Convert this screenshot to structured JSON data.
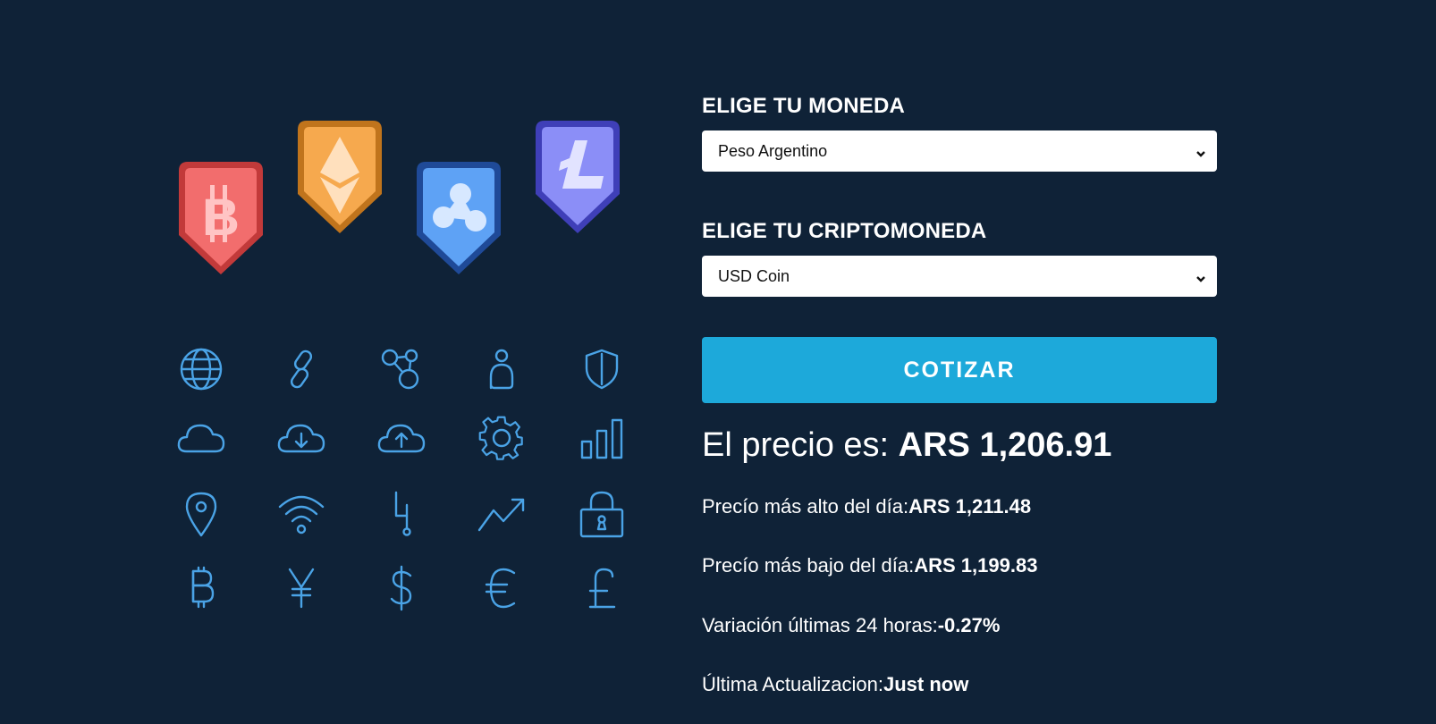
{
  "form": {
    "currency_label": "Elige tu Moneda",
    "currency_selected": "Peso Argentino",
    "crypto_label": "Elige tu Criptomoneda",
    "crypto_selected": "USD Coin",
    "submit_label": "Cotizar"
  },
  "result": {
    "price_prefix": "El precio es: ",
    "price_value": "ARS 1,206.91",
    "high_label": "Precío más alto del día:",
    "high_value": "ARS 1,211.48",
    "low_label": "Precío más bajo del día:",
    "low_value": "ARS 1,199.83",
    "change_label": "Variación últimas 24 horas:",
    "change_value": "-0.27%",
    "updated_label": "Última Actualizacion:",
    "updated_value": "Just now"
  },
  "illustration": {
    "badges": [
      "bitcoin-badge",
      "ethereum-badge",
      "ripple-badge",
      "litecoin-badge"
    ],
    "badge_colors": {
      "bitcoin": "#f26d6d",
      "ethereum": "#f6a94e",
      "ripple": "#5ea2f5",
      "litecoin": "#8b8ef7"
    },
    "icons": [
      "globe-icon",
      "chain-link-icon",
      "network-nodes-icon",
      "user-icon",
      "shield-icon",
      "cloud-icon",
      "cloud-download-icon",
      "cloud-upload-icon",
      "gear-icon",
      "bar-chart-icon",
      "location-pin-icon",
      "wifi-icon",
      "circuit-icon",
      "trend-up-icon",
      "lock-icon",
      "bitcoin-icon",
      "yen-icon",
      "dollar-icon",
      "euro-icon",
      "pound-icon"
    ],
    "icon_color": "#4aa3e6"
  },
  "colors": {
    "background": "#0f2237",
    "button": "#1da9da"
  }
}
